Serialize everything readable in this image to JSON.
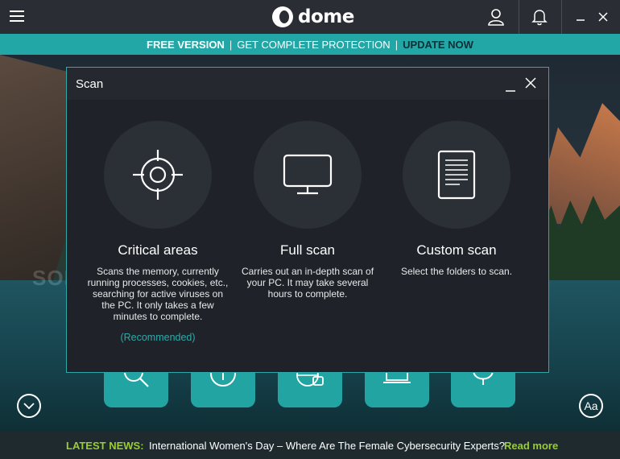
{
  "app": {
    "logo_text": "dome"
  },
  "promo": {
    "free_version": "FREE VERSION",
    "complete_protection": "GET COMPLETE PROTECTION",
    "update_now": "UPDATE NOW",
    "separator": "|"
  },
  "modal": {
    "title": "Scan",
    "options": [
      {
        "title": "Critical areas",
        "description": "Scans the memory, currently running processes, cookies, etc., searching for active viruses on the PC. It only takes a few minutes to complete.",
        "recommended": "(Recommended)",
        "icon": "crosshair-icon"
      },
      {
        "title": "Full scan",
        "description": "Carries out an in-depth scan of your PC. It may take several hours to complete.",
        "icon": "monitor-icon"
      },
      {
        "title": "Custom scan",
        "description": "Select the folders to scan.",
        "icon": "document-icon"
      }
    ]
  },
  "aa_button": "Aa",
  "watermark": "SOFTPEDIA",
  "news": {
    "label": "LATEST NEWS:",
    "headline": "International Women's Day – Where Are The Female Cybersecurity Experts?",
    "read_more": "Read more"
  },
  "colors": {
    "accent": "#23a7a6",
    "news_green": "#9acd32",
    "titlebar": "#2a2d33",
    "modal_bg": "#1f2329"
  }
}
